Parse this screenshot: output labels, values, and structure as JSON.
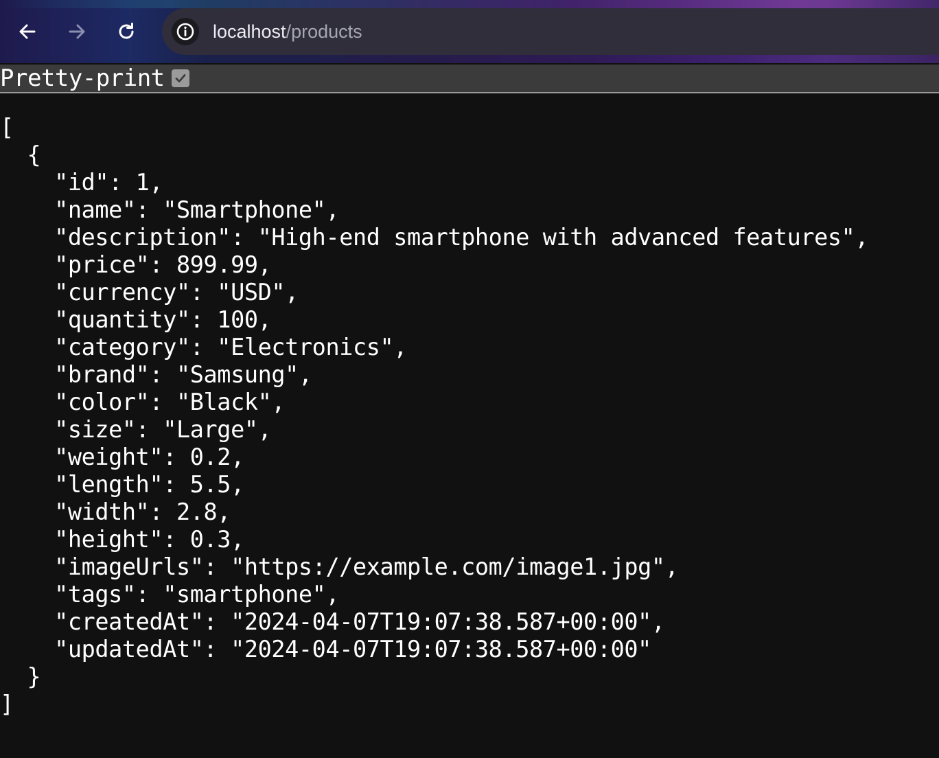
{
  "browser": {
    "url_host": "localhost",
    "url_path": "/products",
    "icons": [
      "back-arrow-icon",
      "forward-arrow-icon",
      "reload-icon",
      "site-info-icon"
    ]
  },
  "viewer": {
    "pretty_print_label": "Pretty-print",
    "pretty_print_checked": true
  },
  "json_lines": [
    "[",
    "  {",
    "    \"id\": 1,",
    "    \"name\": \"Smartphone\",",
    "    \"description\": \"High-end smartphone with advanced features\",",
    "    \"price\": 899.99,",
    "    \"currency\": \"USD\",",
    "    \"quantity\": 100,",
    "    \"category\": \"Electronics\",",
    "    \"brand\": \"Samsung\",",
    "    \"color\": \"Black\",",
    "    \"size\": \"Large\",",
    "    \"weight\": 0.2,",
    "    \"length\": 5.5,",
    "    \"width\": 2.8,",
    "    \"height\": 0.3,",
    "    \"imageUrls\": \"https://example.com/image1.jpg\",",
    "    \"tags\": \"smartphone\",",
    "    \"createdAt\": \"2024-04-07T19:07:38.587+00:00\",",
    "    \"updatedAt\": \"2024-04-07T19:07:38.587+00:00\"",
    "  }",
    "]"
  ]
}
